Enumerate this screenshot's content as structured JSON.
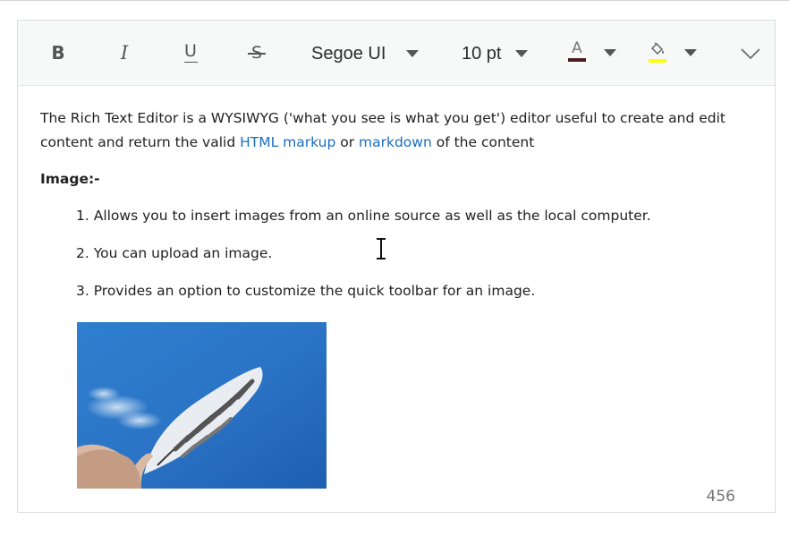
{
  "toolbar": {
    "bold_label": "B",
    "italic_label": "I",
    "underline_label": "U",
    "strike_label": "S",
    "font_name": "Segoe UI",
    "font_size": "10 pt",
    "font_color_label": "A",
    "font_color": "#4b1e1e",
    "highlight_color": "#ffff00"
  },
  "content": {
    "intro_text_1": "The Rich Text Editor is a WYSIWYG ('what you see is what you get') editor useful to create and edit content and return the valid ",
    "link_html": "HTML markup",
    "intro_text_2": " or ",
    "link_markdown": "markdown",
    "intro_text_3": " of the content",
    "heading": "Image:-",
    "list": [
      "1. Allows you to insert images from an online source as well as the local computer.",
      "2. You can upload an image.",
      "3. Provides an option to customize the quick toolbar for an image."
    ]
  },
  "status": {
    "char_count": "456"
  }
}
